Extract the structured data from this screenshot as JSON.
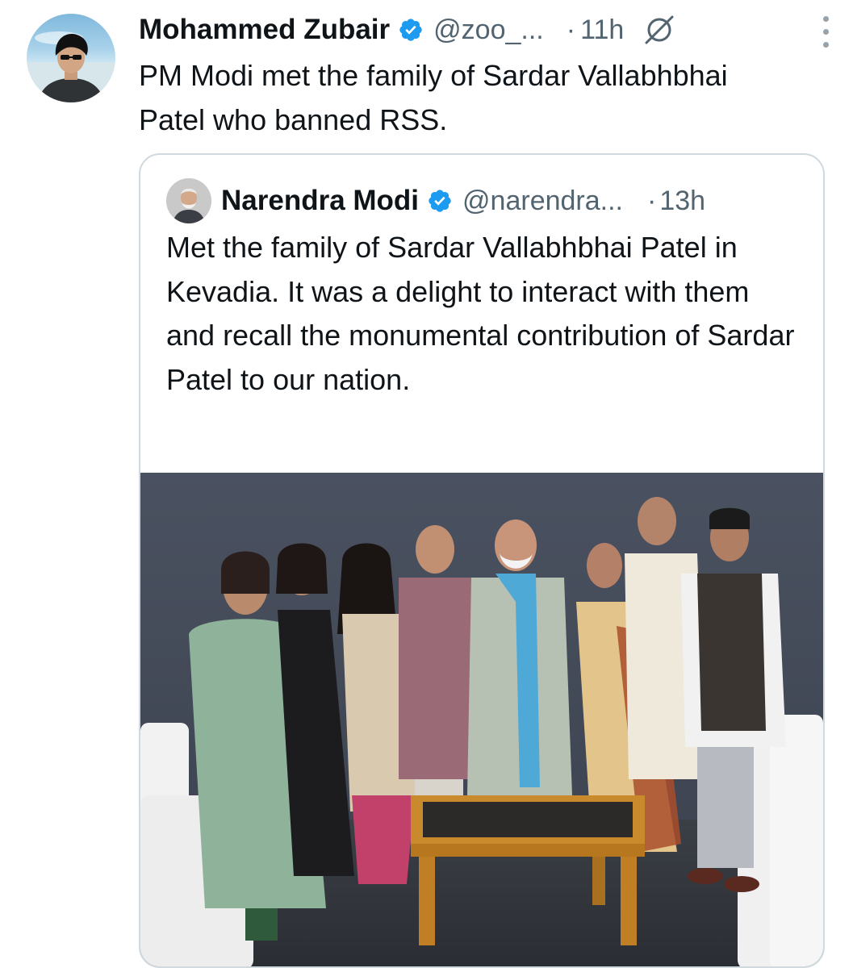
{
  "tweet": {
    "author_name": "Mohammed Zubair",
    "handle": "@zoo_...",
    "separator": "·",
    "time": "11h",
    "text": "PM Modi met the family of Sardar Vallabhbhai Patel who banned RSS."
  },
  "quoted_tweet": {
    "author_name": "Narendra Modi",
    "handle": "@narendra...",
    "separator": "·",
    "time": "13h",
    "text": "Met the family of Sardar Vallabhbhai Patel in Kevadia. It was a delight to interact with them and recall the monumental contribution of Sardar Patel to our nation."
  },
  "icons": {
    "verified": "verified-badge-icon",
    "grok": "grok-icon",
    "more": "more-options-icon"
  },
  "colors": {
    "verified_badge": "#1d9bf0",
    "secondary_text": "#536471",
    "border": "#cfd9de"
  }
}
